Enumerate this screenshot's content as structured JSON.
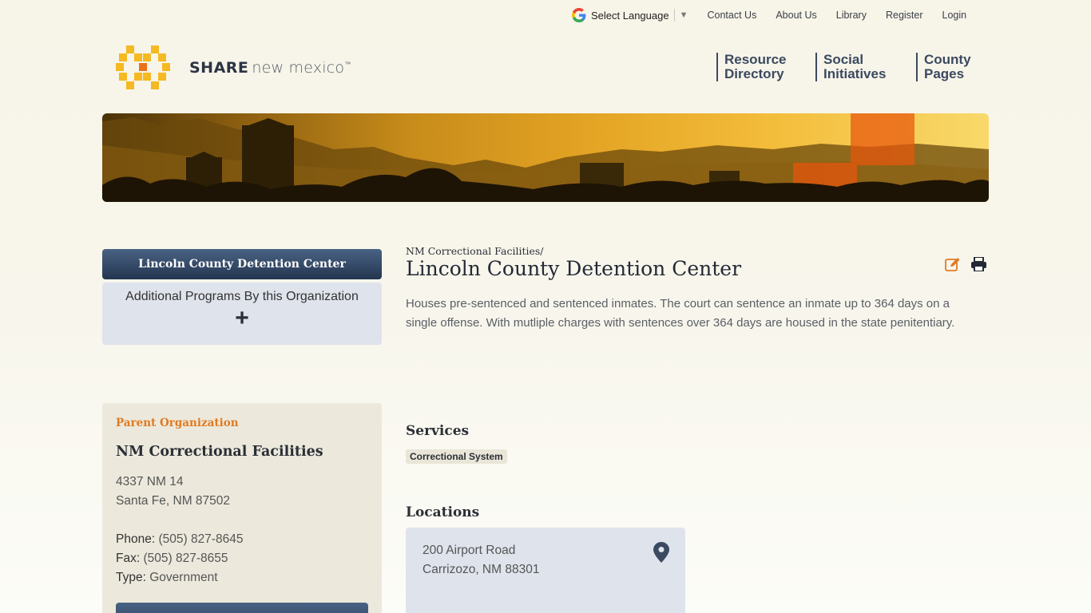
{
  "topbar": {
    "language_label": "Select Language",
    "language_caret": "▼",
    "links": [
      "Contact Us",
      "About Us",
      "Library",
      "Register",
      "Login"
    ]
  },
  "logo": {
    "brand_bold": "SHARE",
    "brand_light": "new mexico",
    "trademark": "™"
  },
  "main_nav": [
    {
      "line1": "Resource",
      "line2": "Directory"
    },
    {
      "line1": "Social",
      "line2": "Initiatives"
    },
    {
      "line1": "County",
      "line2": "Pages"
    }
  ],
  "sidebar": {
    "active_program": "Lincoln County Detention Center",
    "additional_programs_label": "Additional Programs By this Organization",
    "expand_symbol": "+",
    "parent": {
      "section_label": "Parent Organization",
      "name": "NM Correctional Facilities",
      "address_line1": "4337 NM 14",
      "address_line2": "Santa Fe,  NM 87502",
      "phone_label": "Phone:",
      "phone": "(505) 827-8645",
      "fax_label": "Fax:",
      "fax": "(505) 827-8655",
      "type_label": "Type:",
      "type": "Government"
    }
  },
  "content": {
    "breadcrumb": "NM Correctional Facilities/",
    "title": "Lincoln County Detention Center",
    "description": "Houses pre-sentenced and sentenced inmates. The court can sentence an inmate up to 364 days on a single offense. With mutliple charges with sentences over 364 days are housed in the state penitentiary.",
    "services_heading": "Services",
    "services": [
      "Correctional System"
    ],
    "locations_heading": "Locations",
    "location": {
      "address_line1": "200 Airport Road",
      "address_line2": "Carrizozo,  NM 88301"
    }
  },
  "colors": {
    "accent_orange": "#e07a22",
    "navy": "#3b4a60",
    "logo_yellow": "#f5b921",
    "logo_orange": "#e8731c"
  }
}
